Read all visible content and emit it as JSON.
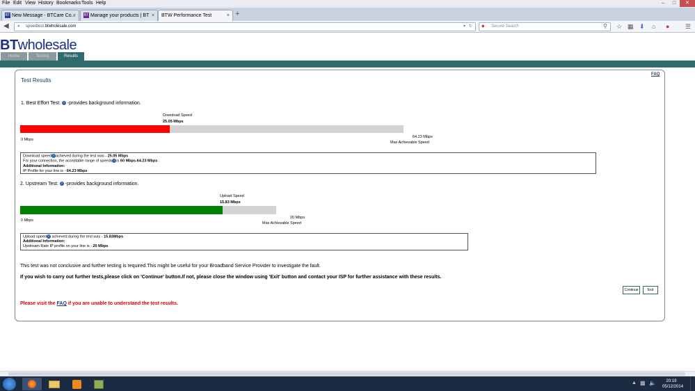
{
  "browser": {
    "menu": [
      "File",
      "Edit",
      "View",
      "History",
      "Bookmarks",
      "Tools",
      "Help"
    ],
    "tabs": [
      {
        "label": "New Message - BTCare Co...",
        "icon": "bt-icon"
      },
      {
        "label": "Manage your products | BT",
        "icon": "bt-icon"
      },
      {
        "label": "BTW Performance Test",
        "icon": "none"
      }
    ],
    "url_prefix": "speedtest.",
    "url_host": "btwholesale.com",
    "search_placeholder": "Secure Search"
  },
  "site": {
    "logo_bt": "BT",
    "logo_rest": "wholesale",
    "tabs": [
      "Home",
      "Testing",
      "Results"
    ],
    "accent": "#2f6b6c"
  },
  "results": {
    "title": "Test Results",
    "faq": "FAQ",
    "best_effort_heading": "1. Best Effort Test:",
    "info_suffix": "-provides background information.",
    "download": {
      "label": "Download Speed",
      "value": "25.05 Mbps",
      "fraction": 0.39,
      "zero": "0 Mbps",
      "max": "64.23 Mbps",
      "max_label": "Max Achievable Speed",
      "color": "#ff0000"
    },
    "download_info": {
      "line1_pre": "Download speed",
      "line1_mid": "achieved during the test was - ",
      "line1_val": "25.05 Mbps",
      "line2_pre": "For your connection, the acceptable range of speeds",
      "line2_mid": "is ",
      "line2_val": "60 Mbps-64.23 Mbps",
      "line2_end": " .",
      "line3": "Additional Information:",
      "line4_pre": "IP Profile for your line is - ",
      "line4_val": "64.23 Mbps"
    },
    "upstream_heading": "2. Upstream Test:",
    "upload": {
      "label": "Upload Speed",
      "value": "15.83 Mbps",
      "fraction": 0.79,
      "zero": "0 Mbps",
      "max": "20 Mbps",
      "max_label": "Max Achievable Speed",
      "color": "#008000"
    },
    "upload_info": {
      "line1_pre": "Upload speed",
      "line1_mid": " achieved during the test was - ",
      "line1_val": "15.83Mbps",
      "line2": "Additional Information:",
      "line3_pre": "Upstream Rate IP profile on your line is - ",
      "line3_val": "20 Mbps"
    },
    "conclusion": "This test was not conclusive and further testing is required.This might be useful for your Broadband Service Provider to investigate the fault.",
    "instructions": "If you wish to carry out further tests,please click on 'Continue' button.If not, please close the window using 'Exit' button and contact your ISP for further assistance with these results.",
    "continue_label": "Continue",
    "exit_label": "Exit",
    "visit_pre": "Please visit the ",
    "visit_link": "FAQ",
    "visit_post": " if you are unable to understand the test results."
  },
  "taskbar": {
    "time": "20:19",
    "date": "05/12/2014"
  }
}
